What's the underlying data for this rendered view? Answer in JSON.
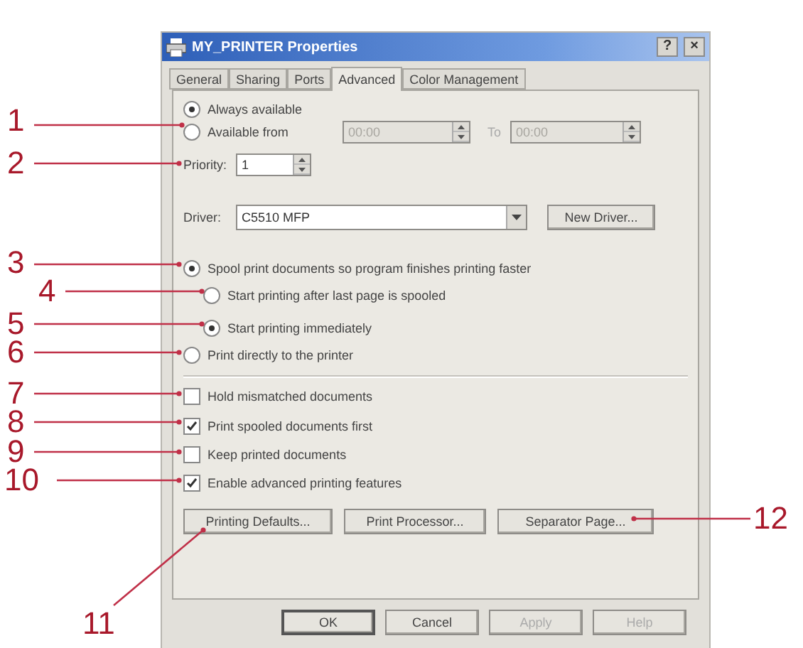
{
  "dialog": {
    "title": "MY_PRINTER Properties",
    "help_button": "?",
    "close_button": "×",
    "tabs": [
      {
        "label": "General",
        "selected": false
      },
      {
        "label": "Sharing",
        "selected": false
      },
      {
        "label": "Ports",
        "selected": false
      },
      {
        "label": "Advanced",
        "selected": true
      },
      {
        "label": "Color Management",
        "selected": false
      }
    ],
    "availability": [
      {
        "label": "Always available",
        "selected": true
      },
      {
        "label": "Available from",
        "selected": false
      }
    ],
    "available_time": {
      "from": "00:00",
      "to_label": "To",
      "to": "00:00",
      "disabled": true
    },
    "priority": {
      "label": "Priority:",
      "value": "1"
    },
    "driver": {
      "label": "Driver:",
      "value": "C5510 MFP",
      "button": "New Driver..."
    },
    "spool_options": [
      {
        "label": "Spool print documents so program finishes printing faster",
        "selected": true,
        "children": [
          {
            "label": "Start printing after last page is spooled",
            "selected": false
          },
          {
            "label": "Start printing immediately",
            "selected": true
          }
        ]
      },
      {
        "label": "Print directly to the printer",
        "selected": false
      }
    ],
    "checkboxes": [
      {
        "label": "Hold mismatched documents",
        "checked": false
      },
      {
        "label": "Print spooled documents first",
        "checked": true
      },
      {
        "label": "Keep printed documents",
        "checked": false
      },
      {
        "label": "Enable advanced printing features",
        "checked": true
      }
    ],
    "buttons": [
      "Printing Defaults...",
      "Print Processor...",
      "Separator Page..."
    ],
    "footer_buttons": [
      {
        "label": "OK",
        "default": true,
        "disabled": false
      },
      {
        "label": "Cancel",
        "default": false,
        "disabled": false
      },
      {
        "label": "Apply",
        "default": false,
        "disabled": true
      },
      {
        "label": "Help",
        "default": false,
        "disabled": true
      }
    ]
  },
  "callouts": [
    "1",
    "2",
    "3",
    "4",
    "5",
    "6",
    "7",
    "8",
    "9",
    "10",
    "11",
    "12"
  ]
}
